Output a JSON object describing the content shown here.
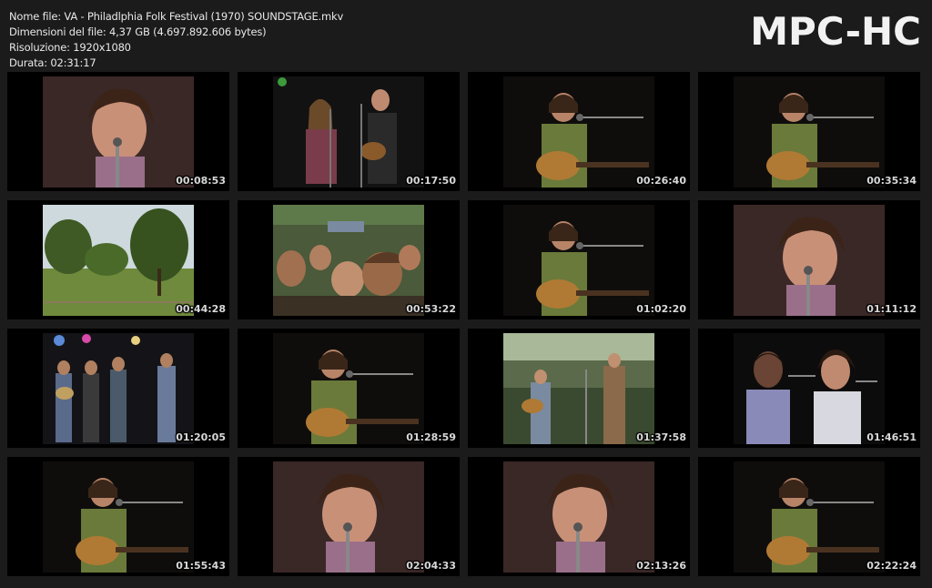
{
  "header": {
    "file_name": "Nome file: VA - Philadlphia Folk Festival (1970) SOUNDSTAGE.mkv",
    "file_size": "Dimensioni del file: 4,37 GB (4.697.892.606 bytes)",
    "resolution": "Risoluzione: 1920x1080",
    "duration": "Durata: 02:31:17",
    "brand": "MPC-HC"
  },
  "thumbnails": [
    {
      "time": "00:08:53",
      "scene": "singer-closeup"
    },
    {
      "time": "00:17:50",
      "scene": "duo-guitars"
    },
    {
      "time": "00:26:40",
      "scene": "guitarist-mic"
    },
    {
      "time": "00:35:34",
      "scene": "guitarist-mic"
    },
    {
      "time": "00:44:28",
      "scene": "landscape-trees"
    },
    {
      "time": "00:53:22",
      "scene": "crowd"
    },
    {
      "time": "01:02:20",
      "scene": "guitarist-mic"
    },
    {
      "time": "01:11:12",
      "scene": "singer-closeup"
    },
    {
      "time": "01:20:05",
      "scene": "band"
    },
    {
      "time": "01:28:59",
      "scene": "guitarist-mic"
    },
    {
      "time": "01:37:58",
      "scene": "outdoor-stage"
    },
    {
      "time": "01:46:51",
      "scene": "duo-singers"
    },
    {
      "time": "01:55:43",
      "scene": "guitarist-mic"
    },
    {
      "time": "02:04:33",
      "scene": "singer-closeup"
    },
    {
      "time": "02:13:26",
      "scene": "singer-closeup"
    },
    {
      "time": "02:22:24",
      "scene": "guitarist-mic"
    }
  ]
}
